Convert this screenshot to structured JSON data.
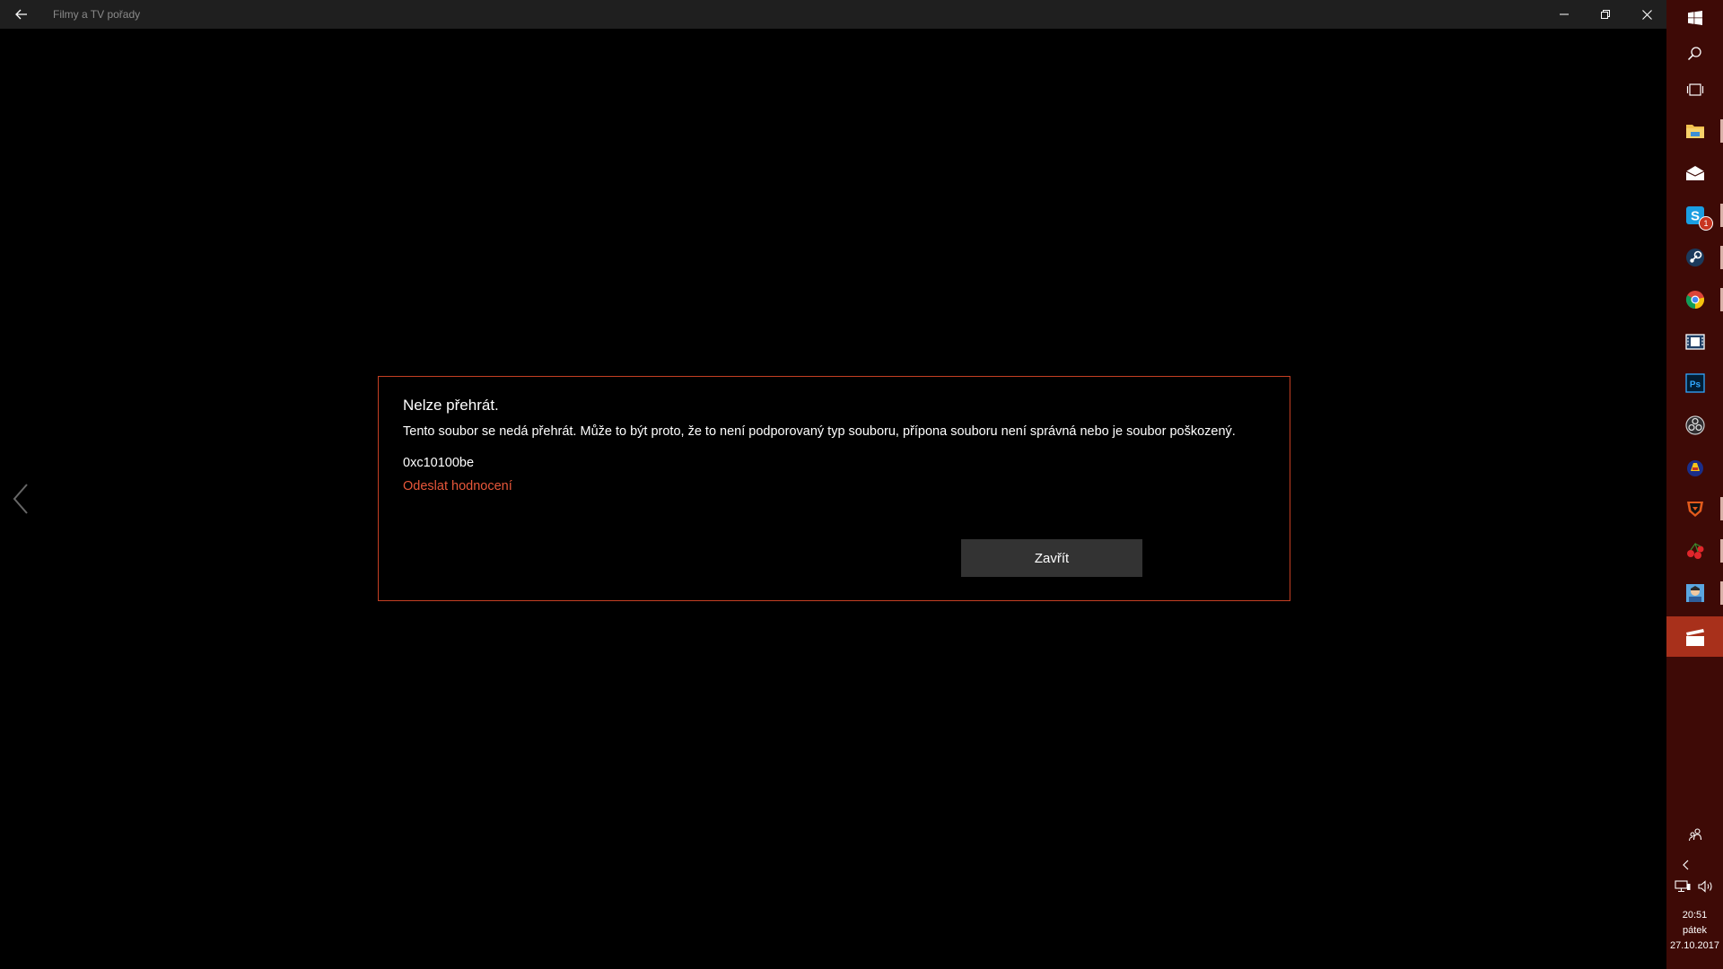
{
  "window": {
    "title": "Filmy a TV pořady"
  },
  "dialog": {
    "title": "Nelze přehrát.",
    "message": "Tento soubor se nedá přehrát. Může to být proto, že to není podporovaný typ souboru, přípona souboru není správná nebo je soubor poškozený.",
    "error_code": "0xc10100be",
    "feedback_link": "Odeslat hodnocení",
    "close_button": "Zavřít"
  },
  "taskbar": {
    "pinned": [
      {
        "name": "file-explorer-icon",
        "running": true
      },
      {
        "name": "mail-icon",
        "running": false
      },
      {
        "name": "skype-icon",
        "running": true,
        "badge": "1"
      },
      {
        "name": "steam-icon",
        "running": true
      },
      {
        "name": "chrome-icon",
        "running": true
      },
      {
        "name": "video-editor-icon",
        "running": false
      },
      {
        "name": "photoshop-icon",
        "running": false
      },
      {
        "name": "obs-icon",
        "running": false
      },
      {
        "name": "game-launcher-icon",
        "running": false
      },
      {
        "name": "shield-app-icon",
        "running": true
      },
      {
        "name": "cherries-app-icon",
        "running": true
      },
      {
        "name": "avatar-app-icon",
        "running": true
      },
      {
        "name": "movies-tv-icon",
        "running": true,
        "active": true
      }
    ],
    "clock": {
      "time": "20:51",
      "day": "pátek",
      "date": "27.10.2017"
    }
  },
  "colors": {
    "accent": "#c43f23",
    "link": "#e8573a",
    "taskbar": "#3e0a06",
    "taskbar_active": "#a8301b",
    "button": "#333333",
    "titlebar": "#1f1f1f"
  }
}
